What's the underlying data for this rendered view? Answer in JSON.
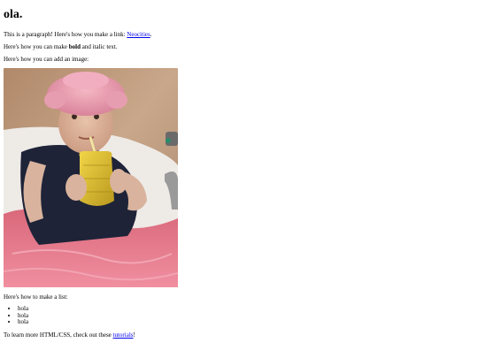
{
  "page": {
    "heading": "ola.",
    "para1": {
      "text": "This is a paragraph! Here's how you make a link: ",
      "link": "Neocities",
      "end": "."
    },
    "para2": {
      "pre": "Here's how you can make ",
      "bold": "bold",
      "post": " and italic text."
    },
    "para3": "Here's how you can add an image:",
    "list_intro": "Here's how to make a list:",
    "list_items": [
      "hola",
      "hola",
      "hola"
    ],
    "footer": {
      "pre": "To learn more HTML/CSS, check out these ",
      "link": "tutorials",
      "end": "!"
    }
  },
  "image": {
    "icon": "photo-of-woman-in-bathtub"
  }
}
